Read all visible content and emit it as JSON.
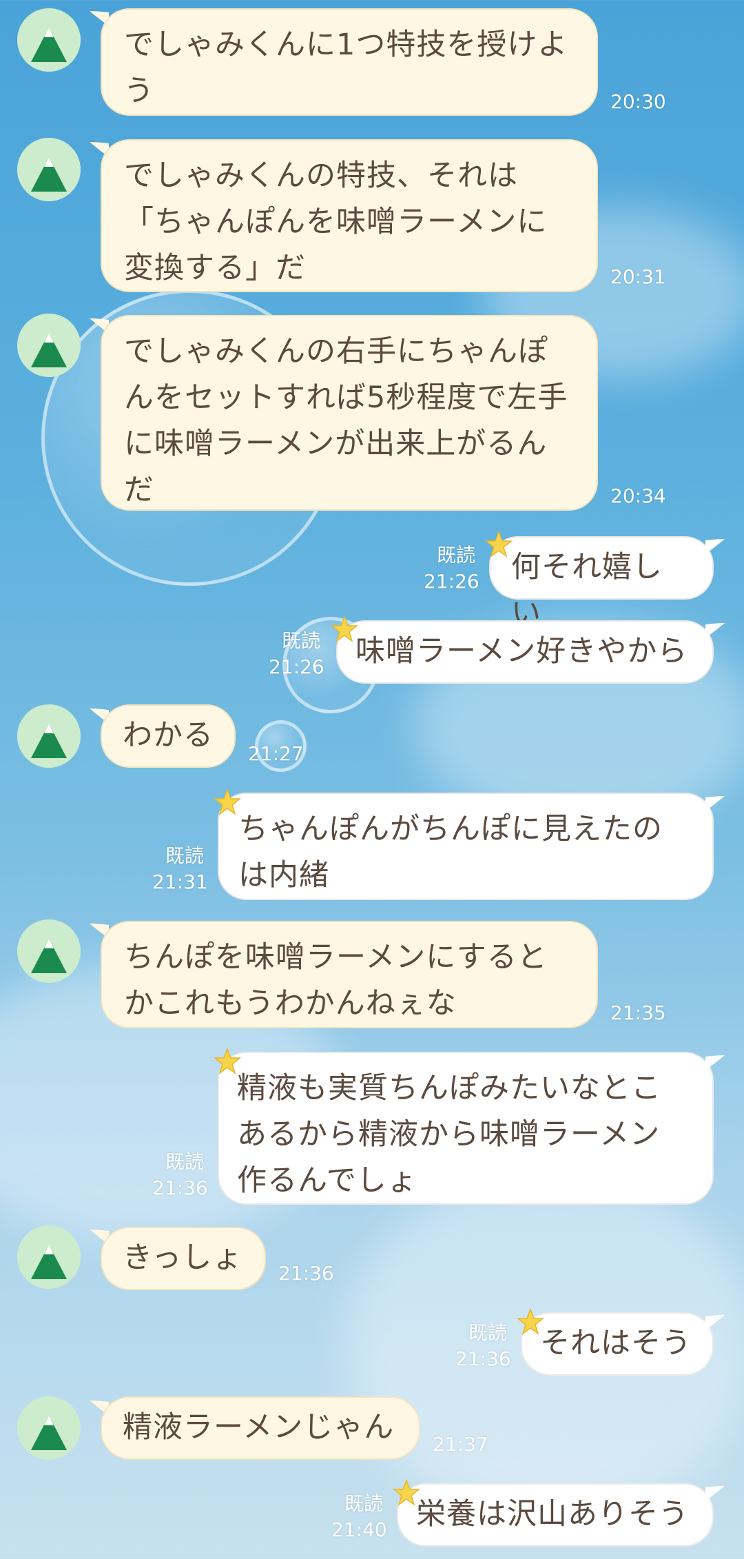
{
  "colors": {
    "left_bubble": "#fdf7e3",
    "right_bubble": "#ffffff",
    "text": "#5b4a3f",
    "avatar_bg": "#cdeccd",
    "avatar_mountain": "#1a8a4e"
  },
  "messages": [
    {
      "side": "left",
      "text": "でしゃみくんに1つ特技を授けよ\nう",
      "time": "20:30"
    },
    {
      "side": "left",
      "text": "でしゃみくんの特技、それは\n「ちゃんぽんを味噌ラーメンに\n変換する」だ",
      "time": "20:31"
    },
    {
      "side": "left",
      "text": "でしゃみくんの右手にちゃんぽ\nんをセットすれば5秒程度で左手\nに味噌ラーメンが出来上がるん\nだ",
      "time": "20:34"
    },
    {
      "side": "right",
      "text": "何それ嬉しい",
      "read": "既読",
      "time": "21:26"
    },
    {
      "side": "right",
      "text": "味噌ラーメン好きやから",
      "read": "既読",
      "time": "21:26"
    },
    {
      "side": "left",
      "text": "わかる",
      "time": "21:27"
    },
    {
      "side": "right",
      "text": "ちゃんぽんがちんぽに見えたの\nは内緒",
      "read": "既読",
      "time": "21:31"
    },
    {
      "side": "left",
      "text": "ちんぽを味噌ラーメンにすると\nかこれもうわかんねぇな",
      "time": "21:35"
    },
    {
      "side": "right",
      "text": "精液も実質ちんぽみたいなとこ\nあるから精液から味噌ラーメン\n作るんでしょ",
      "read": "既読",
      "time": "21:36"
    },
    {
      "side": "left",
      "text": "きっしょ",
      "time": "21:36"
    },
    {
      "side": "right",
      "text": "それはそう",
      "read": "既読",
      "time": "21:36"
    },
    {
      "side": "left",
      "text": "精液ラーメンじゃん",
      "time": "21:37"
    },
    {
      "side": "right",
      "text": "栄養は沢山ありそう",
      "read": "既読",
      "time": "21:40"
    }
  ]
}
